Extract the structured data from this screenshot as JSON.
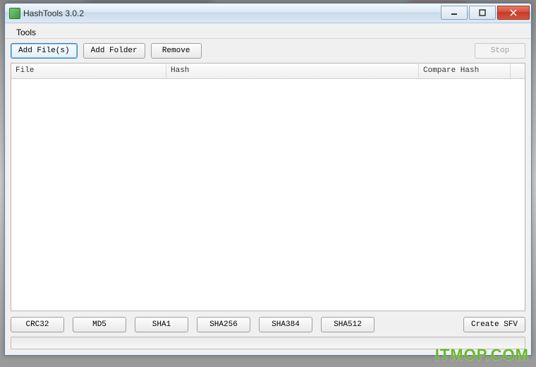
{
  "window": {
    "title": "HashTools 3.0.2"
  },
  "menu": {
    "tools": "Tools"
  },
  "toolbar": {
    "add_files": "Add File(s)",
    "add_folder": "Add Folder",
    "remove": "Remove",
    "stop": "Stop"
  },
  "table": {
    "col_file": "File",
    "col_hash": "Hash",
    "col_compare": "Compare Hash",
    "rows": []
  },
  "hash_buttons": {
    "crc32": "CRC32",
    "md5": "MD5",
    "sha1": "SHA1",
    "sha256": "SHA256",
    "sha384": "SHA384",
    "sha512": "SHA512",
    "create_sfv": "Create SFV"
  },
  "watermark": "ITMOP.COM"
}
